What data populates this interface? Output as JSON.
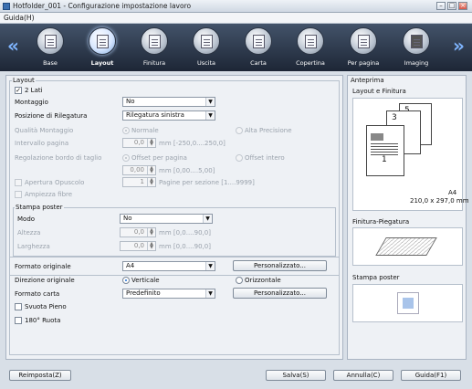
{
  "window": {
    "title": "Hotfolder_001 - Configurazione impostazione lavoro"
  },
  "menu": {
    "guida": "Guida(H)"
  },
  "tabs": [
    {
      "label": "Base"
    },
    {
      "label": "Layout"
    },
    {
      "label": "Finitura"
    },
    {
      "label": "Uscita"
    },
    {
      "label": "Carta"
    },
    {
      "label": "Copertina"
    },
    {
      "label": "Per pagina"
    },
    {
      "label": "Imaging"
    }
  ],
  "layout": {
    "group_title": "Layout",
    "two_sides": "2 Lati",
    "montaggio_label": "Montaggio",
    "montaggio_value": "No",
    "rilegatura_label": "Posizione di Rilegatura",
    "rilegatura_value": "Rilegatura sinistra",
    "qualita_label": "Qualità Montaggio",
    "qualita_normale": "Normale",
    "qualita_alta": "Alta Precisione",
    "intervallo_label": "Intervallo pagina",
    "intervallo_value": "0,0",
    "intervallo_range": "mm [-250,0....250,0]",
    "regolazione_label": "Regolazione bordo di taglio",
    "offset_pagina": "Offset per pagina",
    "offset_intero": "Offset intero",
    "offset_value": "0,00",
    "offset_range": "mm [0,00....5,00]",
    "apertura": "Apertura Opuscolo",
    "pagine_value": "1",
    "pagine_range": "Pagine per sezione [1....9999]",
    "ampiezza": "Ampiezza fibre"
  },
  "poster": {
    "group_title": "Stampa poster",
    "modo_label": "Modo",
    "modo_value": "No",
    "altezza_label": "Altezza",
    "altezza_value": "0,0",
    "altezza_range": "mm [0,0....90,0]",
    "larghezza_label": "Larghezza",
    "larghezza_value": "0,0",
    "larghezza_range": "mm [0,0....90,0]"
  },
  "paper": {
    "formato_label": "Formato originale",
    "formato_value": "A4",
    "personalizza1": "Personalizzato...",
    "direzione_label": "Direzione originale",
    "verticale": "Verticale",
    "orizzontale": "Orizzontale",
    "formato_carta_label": "Formato carta",
    "formato_carta_value": "Predefinito",
    "personalizza2": "Personalizzato...",
    "svuota": "Svuota Pieno",
    "ruota": "180° Ruota"
  },
  "preview": {
    "title": "Anteprima",
    "layout_finitura": "Layout e Finitura",
    "paper_size": "A4",
    "paper_dims": "210,0 x 297,0 mm",
    "page_numbers": [
      "1",
      "3",
      "5"
    ],
    "finitura_piegatura": "Finitura-Piegatura",
    "stampa_poster": "Stampa poster"
  },
  "footer": {
    "reimposta": "Reimposta(Z)",
    "salva": "Salva(S)",
    "annulla": "Annulla(C)",
    "guida": "Guida(F1)"
  }
}
